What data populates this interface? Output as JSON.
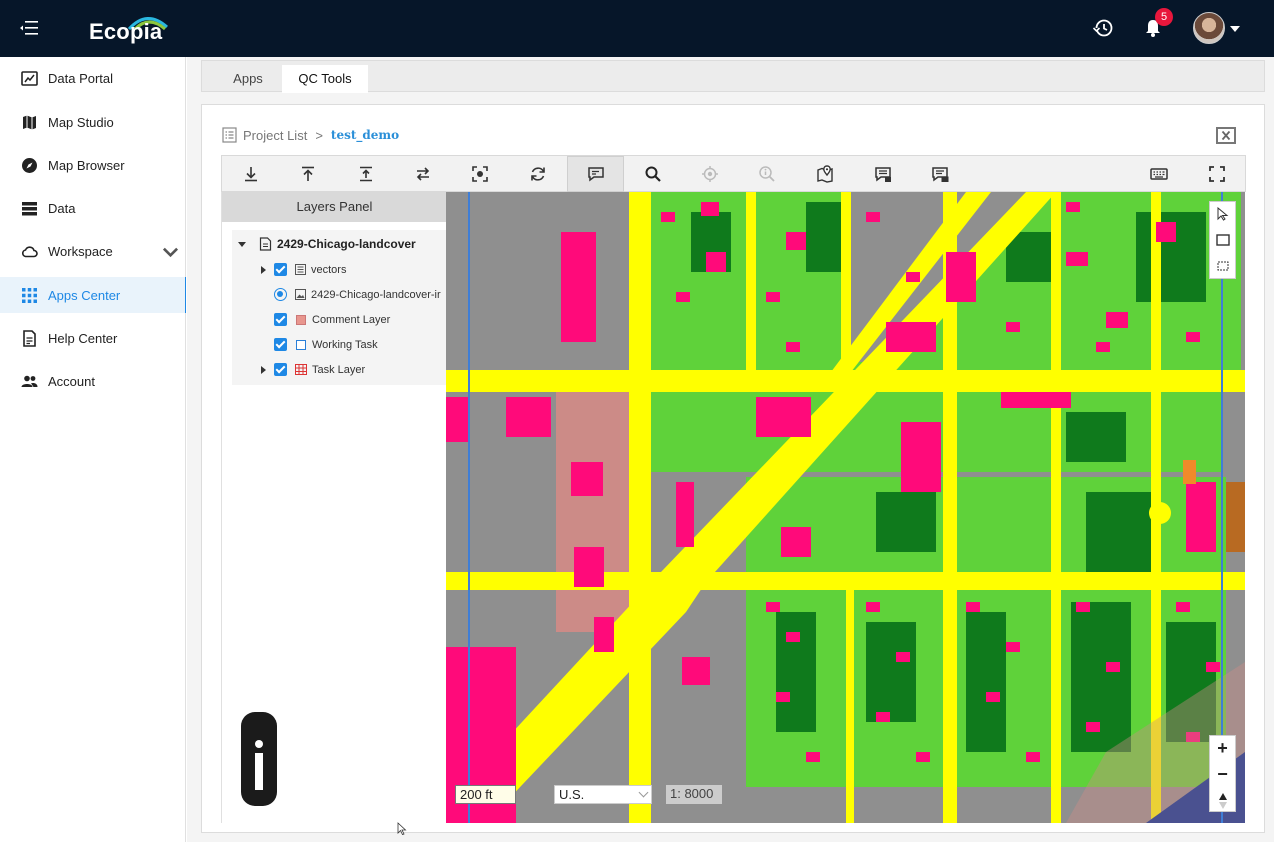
{
  "app": {
    "logo_text": "Ecopia",
    "notification_count": "5"
  },
  "sidebar": {
    "items": [
      {
        "label": "Data Portal",
        "icon": "data-portal-icon"
      },
      {
        "label": "Map Studio",
        "icon": "map-icon"
      },
      {
        "label": "Map Browser",
        "icon": "compass-icon"
      },
      {
        "label": "Data",
        "icon": "storage-icon"
      },
      {
        "label": "Workspace",
        "icon": "cloud-icon"
      },
      {
        "label": "Apps Center",
        "icon": "apps-grid-icon",
        "active": true
      },
      {
        "label": "Help Center",
        "icon": "document-icon"
      },
      {
        "label": "Account",
        "icon": "people-icon"
      }
    ]
  },
  "tabs": [
    {
      "label": "Apps"
    },
    {
      "label": "QC Tools",
      "active": true
    }
  ],
  "breadcrumb": {
    "root": "Project List",
    "separator": ">",
    "current": "test_demo"
  },
  "toolbar": {
    "tools": [
      "download-icon",
      "upload-icon",
      "merge-up-icon",
      "swap-icon",
      "capture-icon",
      "refresh-icon",
      "comment-edit-icon",
      "search-icon",
      "locate-icon",
      "info-search-icon",
      "map-marker-icon",
      "comment-list-icon",
      "comment-check-icon"
    ],
    "right_tools": [
      "keyboard-icon",
      "fullscreen-icon"
    ]
  },
  "layers_panel": {
    "title": "Layers Panel",
    "root": "2429-Chicago-landcover",
    "layers": [
      {
        "label": "vectors"
      },
      {
        "label": "2429-Chicago-landcover-ir"
      },
      {
        "label": "Comment Layer"
      },
      {
        "label": "Working Task"
      },
      {
        "label": "Task Layer"
      }
    ]
  },
  "map": {
    "scale_text": "200 ft",
    "unit_value": "U.S.",
    "ratio_text": "1: 8000",
    "zoom_in": "+",
    "zoom_out": "−",
    "colors": {
      "road": "#ffff00",
      "building": "#ff0a7a",
      "tree": "#0f7a1c",
      "grass": "#5fd23a",
      "impervious": "#8f8f8f",
      "sidewalk": "#cc8b87",
      "boundary": "#3f7ed6"
    }
  }
}
